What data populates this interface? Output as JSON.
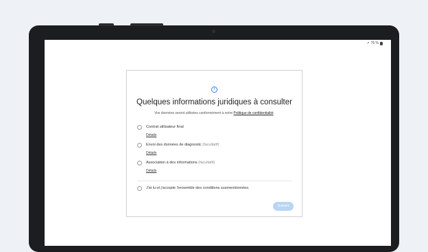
{
  "status_bar": {
    "battery": "76 %"
  },
  "dialog": {
    "info_icon": "info-icon",
    "title": "Quelques informations juridiques à consulter",
    "subtitle_prefix": "Vos données seront utilisées conformément à notre ",
    "subtitle_link": "Politique de confidentialité",
    "subtitle_suffix": ".",
    "items": [
      {
        "label": "Contrat utilisateur final",
        "optional": "",
        "details": "Détails"
      },
      {
        "label": "Envoi des données de diagnostic",
        "optional": " (facultatif)",
        "details": "Détails"
      },
      {
        "label": "Association à des informations",
        "optional": " (facultatif)",
        "details": "Détails"
      }
    ],
    "accept_all": "J'ai lu et j'accepte l'ensemble des conditions susmentionnées.",
    "next_button": "Suivant",
    "accent_color": "#3b7ed6",
    "button_color": "#b9d5f3"
  }
}
